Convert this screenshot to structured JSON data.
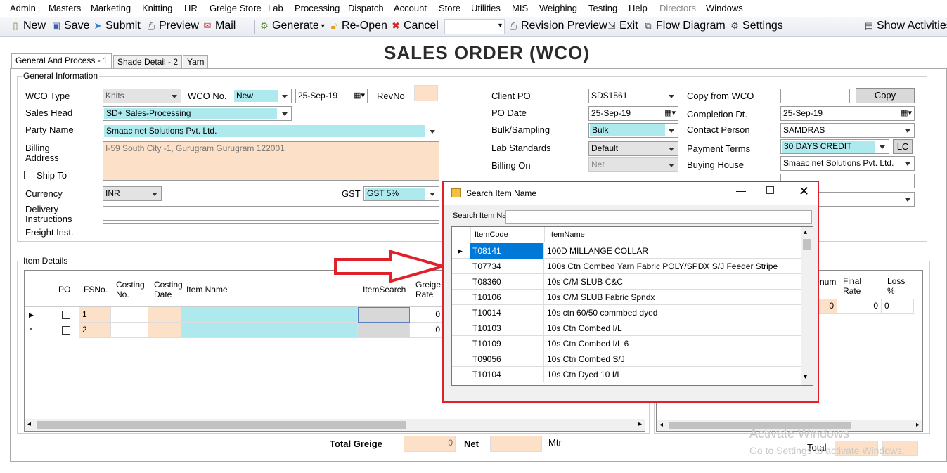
{
  "menu": [
    "Admin",
    "Masters",
    "Marketing",
    "Knitting",
    "HR",
    "Greige Store",
    "Lab",
    "Processing",
    "Dispatch",
    "Account",
    "Store",
    "Utilities",
    "MIS",
    "Weighing",
    "Testing",
    "Help",
    "Directors",
    "Windows"
  ],
  "toolbar": {
    "new": "New",
    "save": "Save",
    "submit": "Submit",
    "preview": "Preview",
    "mail": "Mail",
    "generate": "Generate",
    "reopen": "Re-Open",
    "cancel": "Cancel",
    "revision_preview": "Revision Preview",
    "exit": "Exit",
    "flow_diagram": "Flow Diagram",
    "settings": "Settings",
    "show_activities": "Show Activities"
  },
  "page_title": "SALES ORDER (WCO)",
  "tabs": [
    "General And Process - 1",
    "Shade Detail - 2",
    "Yarn"
  ],
  "general": {
    "group_label": "General Information",
    "wco_type_label": "WCO Type",
    "wco_type": "Knits",
    "wco_no_label": "WCO No.",
    "wco_no": "New",
    "wco_date": "25-Sep-19",
    "revno_label": "RevNo",
    "sales_head_label": "Sales Head",
    "sales_head": "SD+ Sales-Processing",
    "party_name_label": "Party Name",
    "party_name": "Smaac net Solutions Pvt. Ltd.",
    "billing_address_label_1": "Billing",
    "billing_address_label_2": "Address",
    "billing_address": "I-59 South City -1, Gurugram Gurugram 122001",
    "ship_to_label": "Ship To",
    "currency_label": "Currency",
    "currency": "INR",
    "gst_label": "GST",
    "gst": "GST 5%",
    "delivery_label_1": "Delivery",
    "delivery_label_2": "Instructions",
    "freight_label": "Freight Inst.",
    "client_po_label": "Client PO",
    "client_po": "SDS1561",
    "po_date_label": "PO Date",
    "po_date": "25-Sep-19",
    "bulk_label": "Bulk/Sampling",
    "bulk": "Bulk",
    "lab_label": "Lab Standards",
    "lab": "Default",
    "billing_on_label": "Billing On",
    "billing_on": "Net",
    "copy_from_label": "Copy from WCO",
    "copy_button": "Copy",
    "completion_label": "Completion Dt.",
    "completion": "25-Sep-19",
    "contact_label": "Contact Person",
    "contact": "SAMDRAS",
    "payment_label": "Payment Terms",
    "payment": "30 DAYS CREDIT",
    "lc_button": "LC",
    "buying_label": "Buying House",
    "buying": "Smaac net Solutions Pvt. Ltd."
  },
  "items": {
    "group_label": "Item Details",
    "columns": [
      "PO",
      "FSNo.",
      "Costing No.",
      "Costing Date",
      "Item Name",
      "ItemSearch",
      "Greige Rate"
    ],
    "rows": [
      {
        "fsno": "1",
        "rate": "0"
      },
      {
        "fsno": "2",
        "rate": "0"
      }
    ],
    "total_greige_label": "Total Greige",
    "total_greige": "0",
    "net_label": "Net",
    "unit": "Mtr"
  },
  "right_grid": {
    "columns": [
      "num",
      "Final Rate",
      "Loss %"
    ],
    "row": [
      "0",
      "0",
      "0"
    ],
    "total_label": "Total"
  },
  "popup": {
    "title": "Search Item Name",
    "search_label": "Search Item Name",
    "headers": [
      "ItemCode",
      "ItemName"
    ],
    "rows": [
      {
        "code": "T08141",
        "name": "100D MILLANGE  COLLAR"
      },
      {
        "code": "T07734",
        "name": "100s Ctn Combed Yarn Fabric  POLY/SPDX  S/J Feeder Stripe"
      },
      {
        "code": "T08360",
        "name": "10s C/M SLUB C&C"
      },
      {
        "code": "T10106",
        "name": "10s C/M SLUB Fabric Spndx"
      },
      {
        "code": "T10014",
        "name": "10s ctn 60/50 commbed dyed"
      },
      {
        "code": "T10103",
        "name": "10s Ctn Combed I/L"
      },
      {
        "code": "T10109",
        "name": "10s Ctn Combed I/L  6"
      },
      {
        "code": "T09056",
        "name": "10s Ctn Combed S/J"
      },
      {
        "code": "T10104",
        "name": "10s Ctn Dyed 10 I/L"
      }
    ]
  },
  "watermark": {
    "line1": "Activate Windows",
    "line2": "Go to Settings to activate Windows."
  },
  "colors": {
    "cyan": "#aee9ee",
    "peach": "#fde0c8",
    "highlight": "#e0202b",
    "selected": "#0078d7"
  }
}
